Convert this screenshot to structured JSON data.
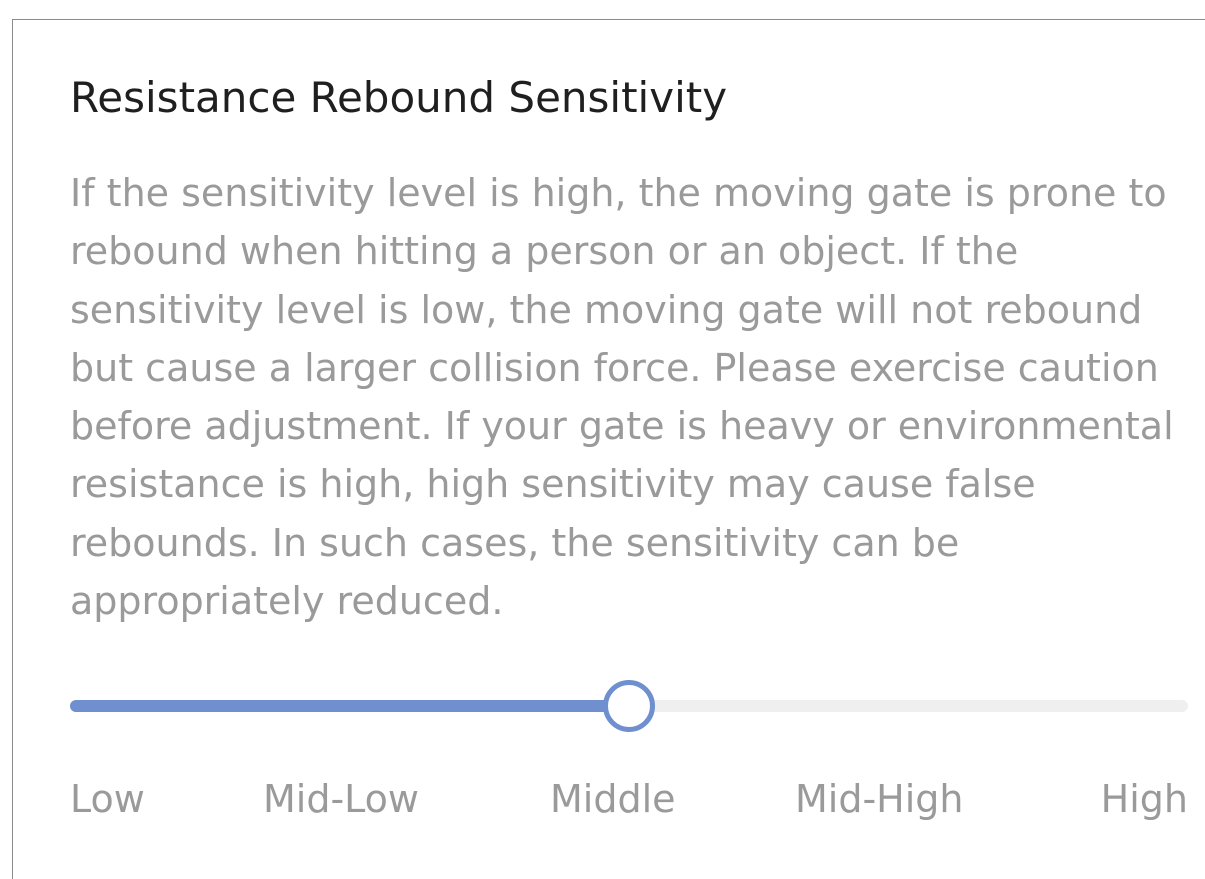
{
  "setting": {
    "title": "Resistance Rebound Sensitivity",
    "description": "If the sensitivity level is high, the moving gate is prone to rebound when hitting a person or an object. If the sensitivity level is low, the moving gate will not rebound but cause a larger collision force. Please exercise caution before adjustment. If your gate is heavy or environmental resistance is high, high sensitivity may cause false rebounds. In such cases, the sensitivity can be appropriately reduced.",
    "levels": [
      "Low",
      "Mid-Low",
      "Middle",
      "Mid-High",
      "High"
    ],
    "selected_level": "Middle",
    "selected_index": 2
  },
  "colors": {
    "accent": "#6f8fcf",
    "track": "#efefef",
    "title_text": "#1f1f1f",
    "secondary_text": "#9a9a9a"
  }
}
